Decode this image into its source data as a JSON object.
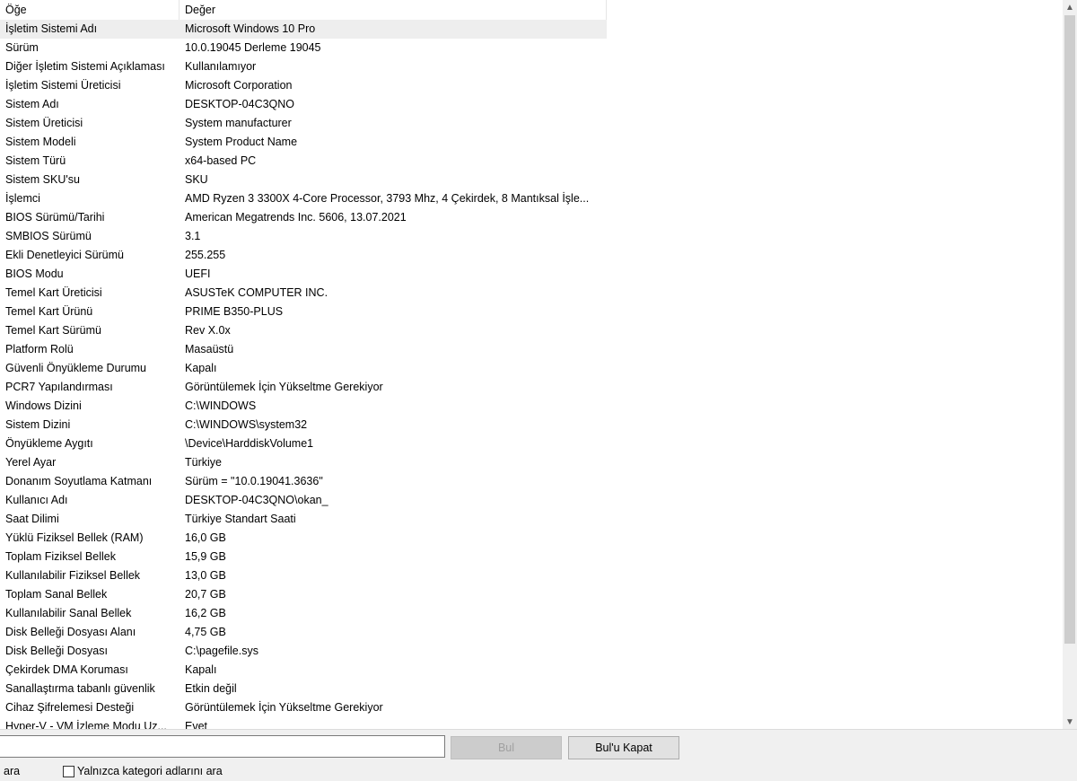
{
  "table": {
    "header": {
      "item": "Öğe",
      "value": "Değer"
    },
    "rows": [
      {
        "k": "İşletim Sistemi Adı",
        "v": "Microsoft Windows 10 Pro"
      },
      {
        "k": "Sürüm",
        "v": "10.0.19045 Derleme 19045"
      },
      {
        "k": "Diğer İşletim Sistemi Açıklaması",
        "v": "Kullanılamıyor"
      },
      {
        "k": "İşletim Sistemi Üreticisi",
        "v": "Microsoft Corporation"
      },
      {
        "k": "Sistem Adı",
        "v": "DESKTOP-04C3QNO"
      },
      {
        "k": "Sistem Üreticisi",
        "v": "System manufacturer"
      },
      {
        "k": "Sistem Modeli",
        "v": "System Product Name"
      },
      {
        "k": "Sistem Türü",
        "v": "x64-based PC"
      },
      {
        "k": "Sistem SKU'su",
        "v": "SKU"
      },
      {
        "k": "İşlemci",
        "v": "AMD Ryzen 3 3300X 4-Core Processor, 3793 Mhz, 4 Çekirdek, 8 Mantıksal İşle..."
      },
      {
        "k": "BIOS Sürümü/Tarihi",
        "v": "American Megatrends Inc. 5606, 13.07.2021"
      },
      {
        "k": "SMBIOS Sürümü",
        "v": "3.1"
      },
      {
        "k": "Ekli Denetleyici Sürümü",
        "v": "255.255"
      },
      {
        "k": "BIOS Modu",
        "v": "UEFI"
      },
      {
        "k": "Temel Kart Üreticisi",
        "v": "ASUSTeK COMPUTER INC."
      },
      {
        "k": "Temel Kart Ürünü",
        "v": "PRIME B350-PLUS"
      },
      {
        "k": "Temel Kart Sürümü",
        "v": "Rev X.0x"
      },
      {
        "k": "Platform Rolü",
        "v": "Masaüstü"
      },
      {
        "k": "Güvenli Önyükleme Durumu",
        "v": "Kapalı"
      },
      {
        "k": "PCR7 Yapılandırması",
        "v": "Görüntülemek İçin Yükseltme Gerekiyor"
      },
      {
        "k": "Windows Dizini",
        "v": "C:\\WINDOWS"
      },
      {
        "k": "Sistem Dizini",
        "v": "C:\\WINDOWS\\system32"
      },
      {
        "k": "Önyükleme Aygıtı",
        "v": "\\Device\\HarddiskVolume1"
      },
      {
        "k": "Yerel Ayar",
        "v": "Türkiye"
      },
      {
        "k": "Donanım Soyutlama Katmanı",
        "v": "Sürüm = \"10.0.19041.3636\""
      },
      {
        "k": "Kullanıcı Adı",
        "v": "DESKTOP-04C3QNO\\okan_"
      },
      {
        "k": "Saat Dilimi",
        "v": "Türkiye Standart Saati"
      },
      {
        "k": "Yüklü Fiziksel Bellek (RAM)",
        "v": "16,0 GB"
      },
      {
        "k": "Toplam Fiziksel Bellek",
        "v": "15,9 GB"
      },
      {
        "k": "Kullanılabilir Fiziksel Bellek",
        "v": "13,0 GB"
      },
      {
        "k": "Toplam Sanal Bellek",
        "v": "20,7 GB"
      },
      {
        "k": "Kullanılabilir Sanal Bellek",
        "v": "16,2 GB"
      },
      {
        "k": "Disk Belleği Dosyası Alanı",
        "v": "4,75 GB"
      },
      {
        "k": "Disk Belleği Dosyası",
        "v": "C:\\pagefile.sys"
      },
      {
        "k": "Çekirdek DMA Koruması",
        "v": "Kapalı"
      },
      {
        "k": "Sanallaştırma tabanlı güvenlik",
        "v": "Etkin değil"
      },
      {
        "k": "Cihaz Şifrelemesi Desteği",
        "v": "Görüntülemek İçin Yükseltme Gerekiyor"
      },
      {
        "k": "Hyper-V - VM İzleme Modu Uz...",
        "v": "Evet"
      }
    ]
  },
  "find": {
    "input_value": "",
    "find_button": "Bul",
    "close_find_button": "Bul'u Kapat",
    "search_label": "ara",
    "category_only_label": "Yalnızca kategori adlarını ara"
  },
  "scrollbar": {
    "up_icon": "scroll-up-icon",
    "down_icon": "scroll-down-icon"
  }
}
